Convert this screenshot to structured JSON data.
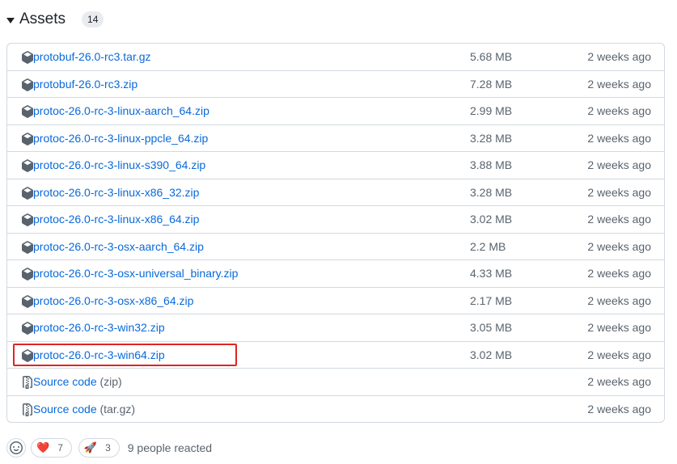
{
  "header": {
    "title": "Assets",
    "count": "14"
  },
  "assets": [
    {
      "name": "protobuf-26.0-rc3.tar.gz",
      "size": "5.68 MB",
      "date": "2 weeks ago",
      "icon": "package-icon"
    },
    {
      "name": "protobuf-26.0-rc3.zip",
      "size": "7.28 MB",
      "date": "2 weeks ago",
      "icon": "package-icon"
    },
    {
      "name": "protoc-26.0-rc-3-linux-aarch_64.zip",
      "size": "2.99 MB",
      "date": "2 weeks ago",
      "icon": "package-icon"
    },
    {
      "name": "protoc-26.0-rc-3-linux-ppcle_64.zip",
      "size": "3.28 MB",
      "date": "2 weeks ago",
      "icon": "package-icon"
    },
    {
      "name": "protoc-26.0-rc-3-linux-s390_64.zip",
      "size": "3.88 MB",
      "date": "2 weeks ago",
      "icon": "package-icon"
    },
    {
      "name": "protoc-26.0-rc-3-linux-x86_32.zip",
      "size": "3.28 MB",
      "date": "2 weeks ago",
      "icon": "package-icon"
    },
    {
      "name": "protoc-26.0-rc-3-linux-x86_64.zip",
      "size": "3.02 MB",
      "date": "2 weeks ago",
      "icon": "package-icon"
    },
    {
      "name": "protoc-26.0-rc-3-osx-aarch_64.zip",
      "size": "2.2 MB",
      "date": "2 weeks ago",
      "icon": "package-icon"
    },
    {
      "name": "protoc-26.0-rc-3-osx-universal_binary.zip",
      "size": "4.33 MB",
      "date": "2 weeks ago",
      "icon": "package-icon"
    },
    {
      "name": "protoc-26.0-rc-3-osx-x86_64.zip",
      "size": "2.17 MB",
      "date": "2 weeks ago",
      "icon": "package-icon"
    },
    {
      "name": "protoc-26.0-rc-3-win32.zip",
      "size": "3.05 MB",
      "date": "2 weeks ago",
      "icon": "package-icon"
    },
    {
      "name": "protoc-26.0-rc-3-win64.zip",
      "size": "3.02 MB",
      "date": "2 weeks ago",
      "icon": "package-icon"
    }
  ],
  "source_code": [
    {
      "label": "Source code",
      "ext": "(zip)",
      "date": "2 weeks ago",
      "icon": "file-zip-icon"
    },
    {
      "label": "Source code",
      "ext": "(tar.gz)",
      "date": "2 weeks ago",
      "icon": "file-zip-icon"
    }
  ],
  "reactions": {
    "heart": {
      "emoji": "❤️",
      "count": "7"
    },
    "rocket": {
      "emoji": "🚀",
      "count": "3"
    },
    "summary": "9 people reacted"
  },
  "colors": {
    "link": "#0969da",
    "muted": "#59636e",
    "border": "#d1d9e0",
    "highlight": "#e02424"
  }
}
